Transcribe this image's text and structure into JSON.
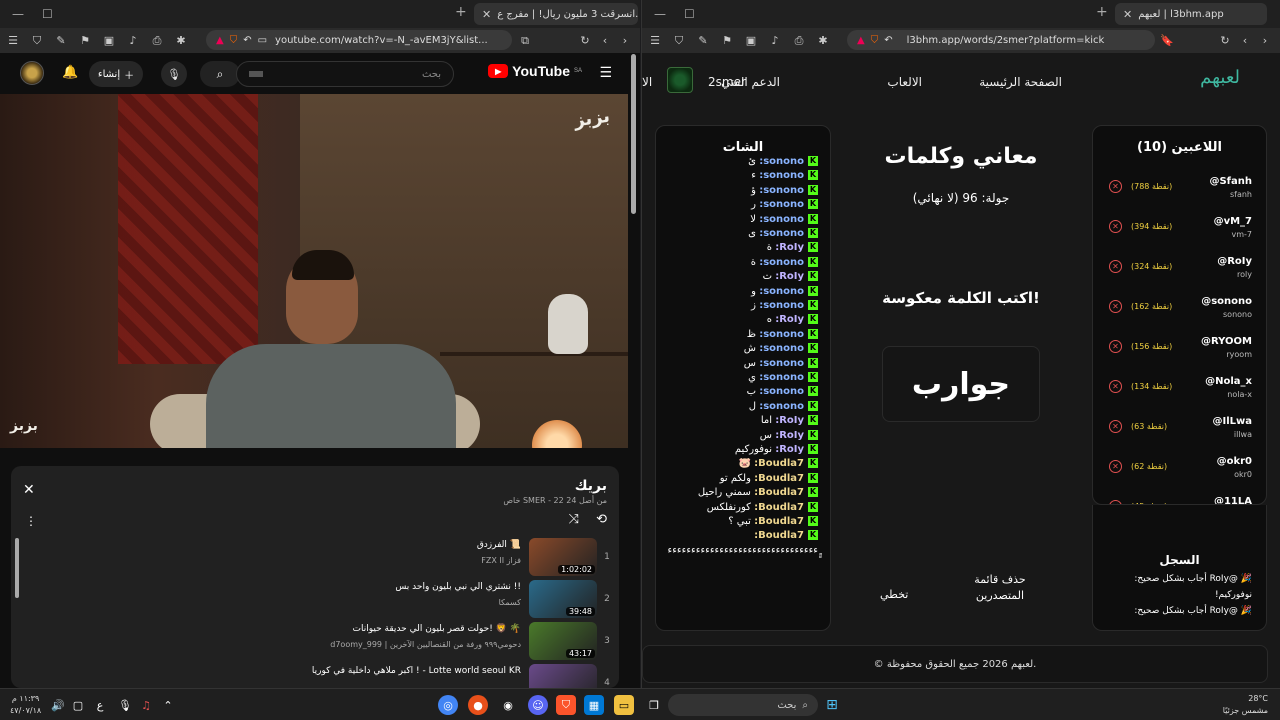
{
  "left_window": {
    "tab_title": "انسرقت 3 مليون ريال! | مفرج ع...",
    "url": "youtube.com/watch?v=-N_-avEM3jY&list...",
    "youtube": {
      "logo_text": "YouTube",
      "region": "SA",
      "search_placeholder": "بحث",
      "create_label": "إنشاء",
      "watermark": "بزبز",
      "playlist": {
        "title": "بريك",
        "subtitle": "خاص SMER - 22 من أصل 24",
        "items": [
          {
            "num": "1",
            "title": "الفرزدق 📜",
            "channel": "FZX II فزاز",
            "duration": "1:02:02",
            "color": "#8a4a2a"
          },
          {
            "num": "2",
            "title": "نشتري الي نبي بليون واحد بس !!",
            "channel": "كسمكا",
            "duration": "39:48",
            "color": "#2a6a8a"
          },
          {
            "num": "3",
            "title": "حولت قصر بليون الي حديقة حيوانات! 🦁 🌴",
            "channel": "d7oomy_999 | دحومي٩٩٩ ورفة من القنصاليين الآخرين",
            "duration": "43:17",
            "color": "#4a7a2a"
          },
          {
            "num": "4",
            "title": "اكبر ملاهي داخلية في كوريا ! - Lotte world seoul KR",
            "channel": "",
            "duration": "",
            "color": "#6a4a8a"
          }
        ]
      }
    }
  },
  "right_window": {
    "tab_title": "لعبهم | l3bhm.app",
    "url": "l3bhm.app/words/2smer?platform=kick",
    "site": {
      "logo": "لعبهم",
      "nav": {
        "home": "الصفحة الرئيسية",
        "games": "الالعاب",
        "support": "الدعم الفني",
        "user": "2smer",
        "partial": "الا"
      },
      "game_title": "معاني وكلمات",
      "round": "جولة: 96 (لا نهائي)",
      "instruction": "اكتب الكلمة معكوسة!",
      "word": "جوارب",
      "skip": "تخطي",
      "delete_leaderboard": "حذف قائمة المتصدرين",
      "footer": "© لعبهم 2026 جميع الحقوق محفوظة."
    },
    "players": {
      "title": "اللاعبين (10)",
      "list": [
        {
          "name": "@Sfanh",
          "user": "sfanh",
          "points": "(788 نقطة)"
        },
        {
          "name": "@vM_7",
          "user": "vm-7",
          "points": "(394 نقطة)"
        },
        {
          "name": "@RoIy",
          "user": "roly",
          "points": "(324 نقطة)"
        },
        {
          "name": "@sonono",
          "user": "sonono",
          "points": "(162 نقطة)"
        },
        {
          "name": "@RYOOM",
          "user": "ryoom",
          "points": "(156 نقطة)"
        },
        {
          "name": "@Nola_x",
          "user": "nola-x",
          "points": "(134 نقطة)"
        },
        {
          "name": "@IlLwa",
          "user": "illwa",
          "points": "(63 نقطة)"
        },
        {
          "name": "@okr0",
          "user": "okr0",
          "points": "(62 نقطة)"
        },
        {
          "name": "@11LA",
          "user": "11la",
          "points": "(45 نقطة)"
        }
      ]
    },
    "log": {
      "title": "السجل",
      "entries": [
        "🎉 @RoIy أجاب بشكل صحيح: نوفوركيم!",
        "🎉 @RoIy أجاب بشكل صحيح:"
      ]
    },
    "chat": {
      "title": "الشات",
      "messages": [
        {
          "user": "sonono:",
          "msg": "ئ",
          "color": "#8ab4ff"
        },
        {
          "user": "sonono:",
          "msg": "ء",
          "color": "#8ab4ff"
        },
        {
          "user": "sonono:",
          "msg": "ؤ",
          "color": "#8ab4ff"
        },
        {
          "user": "sonono:",
          "msg": "ر",
          "color": "#8ab4ff"
        },
        {
          "user": "sonono:",
          "msg": "لا",
          "color": "#8ab4ff"
        },
        {
          "user": "sonono:",
          "msg": "ى",
          "color": "#8ab4ff"
        },
        {
          "user": "RoIy:",
          "msg": "ة",
          "color": "#c0b4ff"
        },
        {
          "user": "sonono:",
          "msg": "ة",
          "color": "#8ab4ff"
        },
        {
          "user": "RoIy:",
          "msg": "ت",
          "color": "#c0b4ff"
        },
        {
          "user": "sonono:",
          "msg": "و",
          "color": "#8ab4ff"
        },
        {
          "user": "sonono:",
          "msg": "ز",
          "color": "#8ab4ff"
        },
        {
          "user": "RoIy:",
          "msg": "ه",
          "color": "#c0b4ff"
        },
        {
          "user": "sonono:",
          "msg": "ظ",
          "color": "#8ab4ff"
        },
        {
          "user": "sonono:",
          "msg": "ش",
          "color": "#8ab4ff"
        },
        {
          "user": "sonono:",
          "msg": "س",
          "color": "#8ab4ff"
        },
        {
          "user": "sonono:",
          "msg": "ي",
          "color": "#8ab4ff"
        },
        {
          "user": "sonono:",
          "msg": "ب",
          "color": "#8ab4ff"
        },
        {
          "user": "sonono:",
          "msg": "ل",
          "color": "#8ab4ff"
        },
        {
          "user": "RoIy:",
          "msg": "اما",
          "color": "#c0b4ff"
        },
        {
          "user": "RoIy:",
          "msg": "س",
          "color": "#c0b4ff"
        },
        {
          "user": "RoIy:",
          "msg": "نوفوركيم",
          "color": "#c0b4ff"
        },
        {
          "user": "Boudla7:",
          "msg": "🐷",
          "color": "#f0d890"
        },
        {
          "user": "Boudla7:",
          "msg": "ولكم تو",
          "color": "#f0d890"
        },
        {
          "user": "Boudla7:",
          "msg": "سمني راحيل",
          "color": "#f0d890"
        },
        {
          "user": "Boudla7:",
          "msg": "كورنفلكس",
          "color": "#f0d890"
        },
        {
          "user": "Boudla7:",
          "msg": "تبي ؟",
          "color": "#f0d890"
        },
        {
          "user": "Boudla7:",
          "msg": "",
          "color": "#f0d890"
        },
        {
          "user": "",
          "msg": "ٍٍءءءءءءءءءءءءءءءءءءءءءءءءءءءءءءءء",
          "color": "#fff"
        }
      ]
    }
  },
  "taskbar": {
    "search_placeholder": "بحث",
    "weather_temp": "28°C",
    "weather_desc": "مشمس جزئيًا",
    "time": "١١:٣٩ م",
    "date": "٤٧/٠٧/١٨",
    "lang": "ع"
  }
}
